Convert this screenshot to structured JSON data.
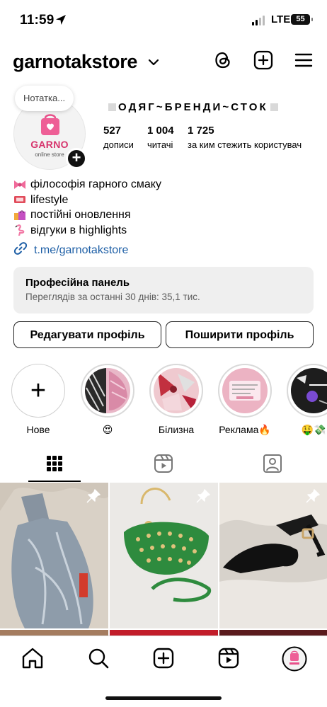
{
  "status_bar": {
    "time": "11:59",
    "network": "LTE",
    "battery": "55"
  },
  "header": {
    "username": "garnotakstore",
    "icons": [
      "threads-icon",
      "create-icon",
      "menu-icon"
    ]
  },
  "profile": {
    "note_placeholder": "Нотатка...",
    "avatar_brand": "GARNO",
    "avatar_sub": "online store",
    "full_name": "ОДЯГ~БРЕНДИ~СТОК",
    "stats": [
      {
        "value": "527",
        "label": "дописи"
      },
      {
        "value": "1 004",
        "label": "читачі"
      },
      {
        "value": "1 725",
        "label": "за ким стежить користувач"
      }
    ]
  },
  "bio": {
    "lines": [
      {
        "emoji": "ribbon-icon",
        "text": "філософія гарного смаку"
      },
      {
        "emoji": "ticket-icon",
        "text": "lifestyle"
      },
      {
        "emoji": "shopping-bags-icon",
        "text": "постійні оновлення"
      },
      {
        "emoji": "flamingo-icon",
        "text": "відгуки в highlights"
      }
    ],
    "link": "t.me/garnotakstore"
  },
  "professional_panel": {
    "title": "Професійна панель",
    "subtitle": "Переглядів за останні 30 днів: 35,1 тис."
  },
  "buttons": {
    "edit_profile": "Редагувати профіль",
    "share_profile": "Поширити профіль"
  },
  "highlights": [
    {
      "label": "Нове"
    },
    {
      "label": "😍"
    },
    {
      "label": "Білизна"
    },
    {
      "label": "Реклама🔥"
    },
    {
      "label": "🤑💸"
    }
  ],
  "tabs": [
    "grid-icon",
    "reels-icon",
    "tagged-icon"
  ],
  "bottom_nav": [
    "home-icon",
    "search-icon",
    "create-icon",
    "reels-icon",
    "profile-avatar"
  ],
  "colors": {
    "brand_pink": "#e8508a",
    "link_blue": "#1e5fa6",
    "panel_bg": "#efefef"
  }
}
